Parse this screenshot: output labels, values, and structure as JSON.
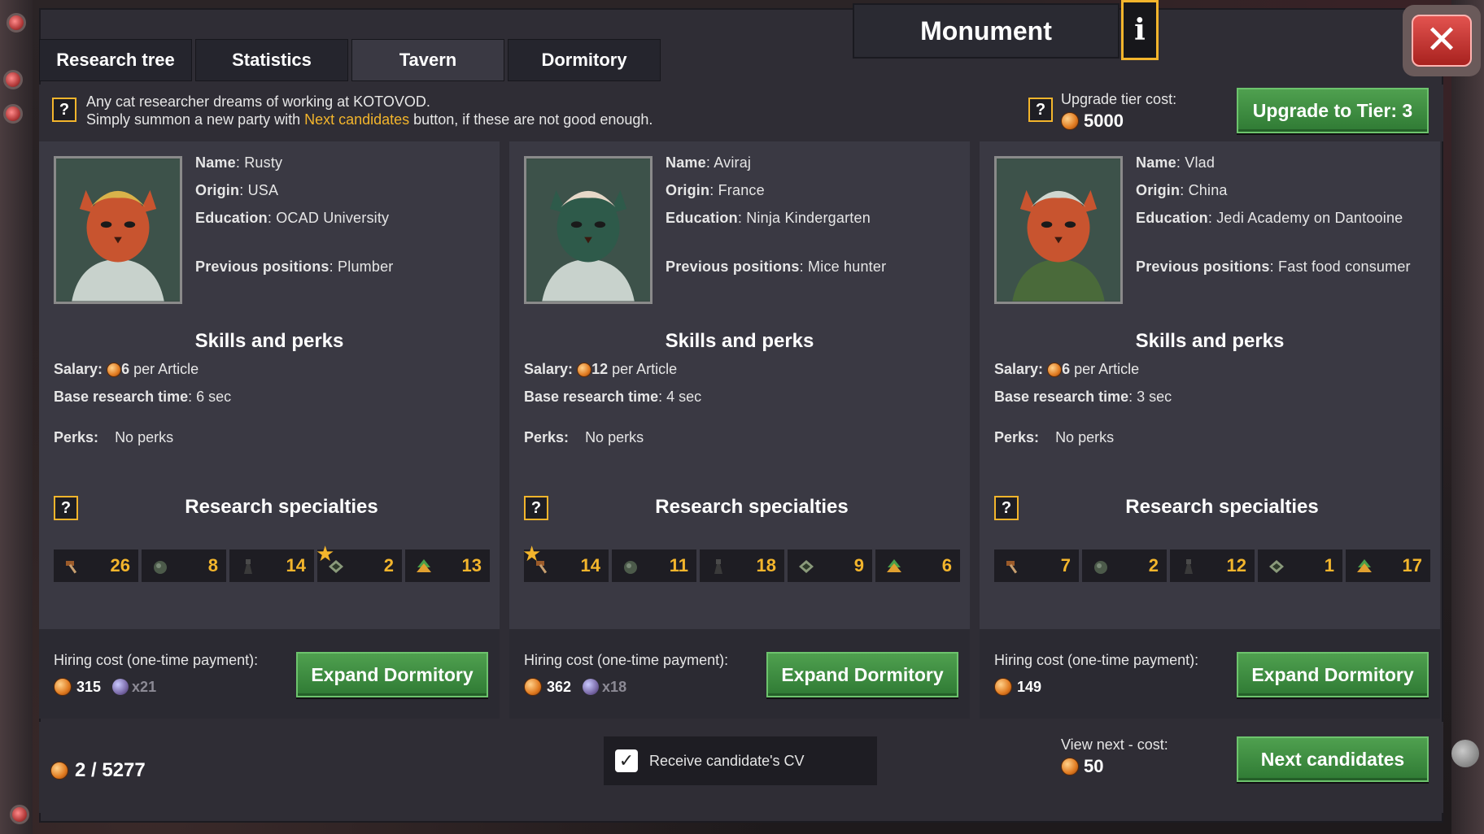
{
  "window": {
    "title": "Monument",
    "info_glyph": "i",
    "close_glyph": "✕"
  },
  "tabs": [
    {
      "label": "Research tree"
    },
    {
      "label": "Statistics"
    },
    {
      "label": "Tavern",
      "active": true
    },
    {
      "label": "Dormitory"
    }
  ],
  "intro": {
    "line1": "Any cat researcher dreams of working at KOTOVOD.",
    "line2_pre": "Simply summon a new party with ",
    "line2_link": "Next candidates",
    "line2_post": " button, if these are not good enough."
  },
  "upgrade": {
    "label": "Upgrade tier cost:",
    "cost": "5000",
    "button": "Upgrade to Tier: 3"
  },
  "labels": {
    "name": "Name",
    "origin": "Origin",
    "education": "Education",
    "previous": "Previous positions",
    "skills_title": "Skills and perks",
    "salary": "Salary:",
    "per_article": "per Article",
    "base_time": "Base research time",
    "perks": "Perks:",
    "specialties_title": "Research specialties",
    "hiring_cost": "Hiring cost (one-time payment):",
    "expand": "Expand Dormitory",
    "help_glyph": "?"
  },
  "candidates": [
    {
      "name": "Rusty",
      "origin": "USA",
      "education": "OCAD University",
      "previous": "Plumber",
      "salary": "6",
      "base_time": "6 sec",
      "perks": "No perks",
      "specialties": [
        {
          "icon": "hammer-icon",
          "value": "26",
          "star": false
        },
        {
          "icon": "stone-icon",
          "value": "8",
          "star": false
        },
        {
          "icon": "flask-icon",
          "value": "14",
          "star": false
        },
        {
          "icon": "diamond-icon",
          "value": "2",
          "star": true
        },
        {
          "icon": "tree-icon",
          "value": "13",
          "star": false
        }
      ],
      "hire_coins": "315",
      "hire_gems": "x21",
      "palette": {
        "fur": "#c8542f",
        "hair": "#d9b24a",
        "coat": "#c8d2cc"
      }
    },
    {
      "name": "Aviraj",
      "origin": "France",
      "education": "Ninja Kindergarten",
      "previous": "Mice hunter",
      "salary": "12",
      "base_time": "4 sec",
      "perks": "No perks",
      "specialties": [
        {
          "icon": "hammer-icon",
          "value": "14",
          "star": true
        },
        {
          "icon": "stone-icon",
          "value": "11",
          "star": false
        },
        {
          "icon": "flask-icon",
          "value": "18",
          "star": false
        },
        {
          "icon": "diamond-icon",
          "value": "9",
          "star": false
        },
        {
          "icon": "tree-icon",
          "value": "6",
          "star": false
        }
      ],
      "hire_coins": "362",
      "hire_gems": "x18",
      "palette": {
        "fur": "#2e5a4a",
        "hair": "#e6d8c8",
        "coat": "#c8d2cc"
      }
    },
    {
      "name": "Vlad",
      "origin": "China",
      "education": "Jedi Academy on Dantooine",
      "previous": "Fast food consumer",
      "salary": "6",
      "base_time": "3 sec",
      "perks": "No perks",
      "specialties": [
        {
          "icon": "hammer-icon",
          "value": "7",
          "star": false
        },
        {
          "icon": "stone-icon",
          "value": "2",
          "star": false
        },
        {
          "icon": "flask-icon",
          "value": "12",
          "star": false
        },
        {
          "icon": "diamond-icon",
          "value": "1",
          "star": false
        },
        {
          "icon": "tree-icon",
          "value": "17",
          "star": false
        }
      ],
      "hire_coins": "149",
      "hire_gems": "",
      "palette": {
        "fur": "#c8542f",
        "hair": "#cfd6cf",
        "coat": "#4a6a3a"
      }
    }
  ],
  "footer": {
    "funds": "2 / 5277",
    "receive_cv": "Receive candidate's CV",
    "receive_cv_checked": true,
    "next_label": "View next - cost:",
    "next_cost": "50",
    "next_button": "Next candidates"
  }
}
